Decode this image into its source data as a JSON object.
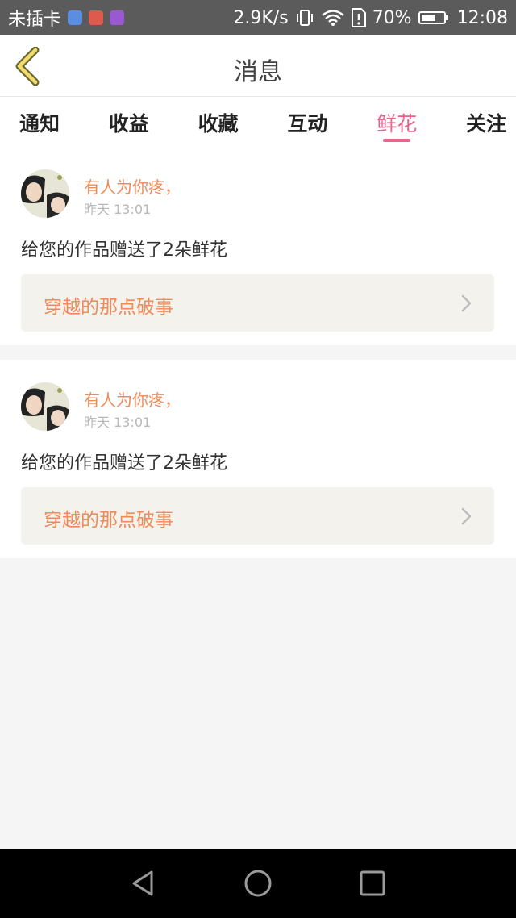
{
  "status_bar": {
    "carrier": "未插卡",
    "speed": "2.9K/s",
    "battery": "70%",
    "battery_level": 0.7,
    "time": "12:08",
    "app_icon_colors": [
      "#5b8de0",
      "#e0594f",
      "#9a58d1"
    ]
  },
  "header": {
    "title": "消息"
  },
  "tabs": [
    {
      "label": "通知",
      "active": false
    },
    {
      "label": "收益",
      "active": false
    },
    {
      "label": "收藏",
      "active": false
    },
    {
      "label": "互动",
      "active": false
    },
    {
      "label": "鲜花",
      "active": true
    },
    {
      "label": "关注",
      "active": false
    }
  ],
  "messages": [
    {
      "user": "有人为你疼，",
      "time": "昨天 13:01",
      "text": "给您的作品赠送了2朵鲜花",
      "work_title": "穿越的那点破事"
    },
    {
      "user": "有人为你疼，",
      "time": "昨天 13:01",
      "text": "给您的作品赠送了2朵鲜花",
      "work_title": "穿越的那点破事"
    }
  ],
  "colors": {
    "accent": "#e8648a",
    "orange": "#f08a58",
    "status_bar": "#5b5b5b",
    "background": "#f5f5f5"
  }
}
